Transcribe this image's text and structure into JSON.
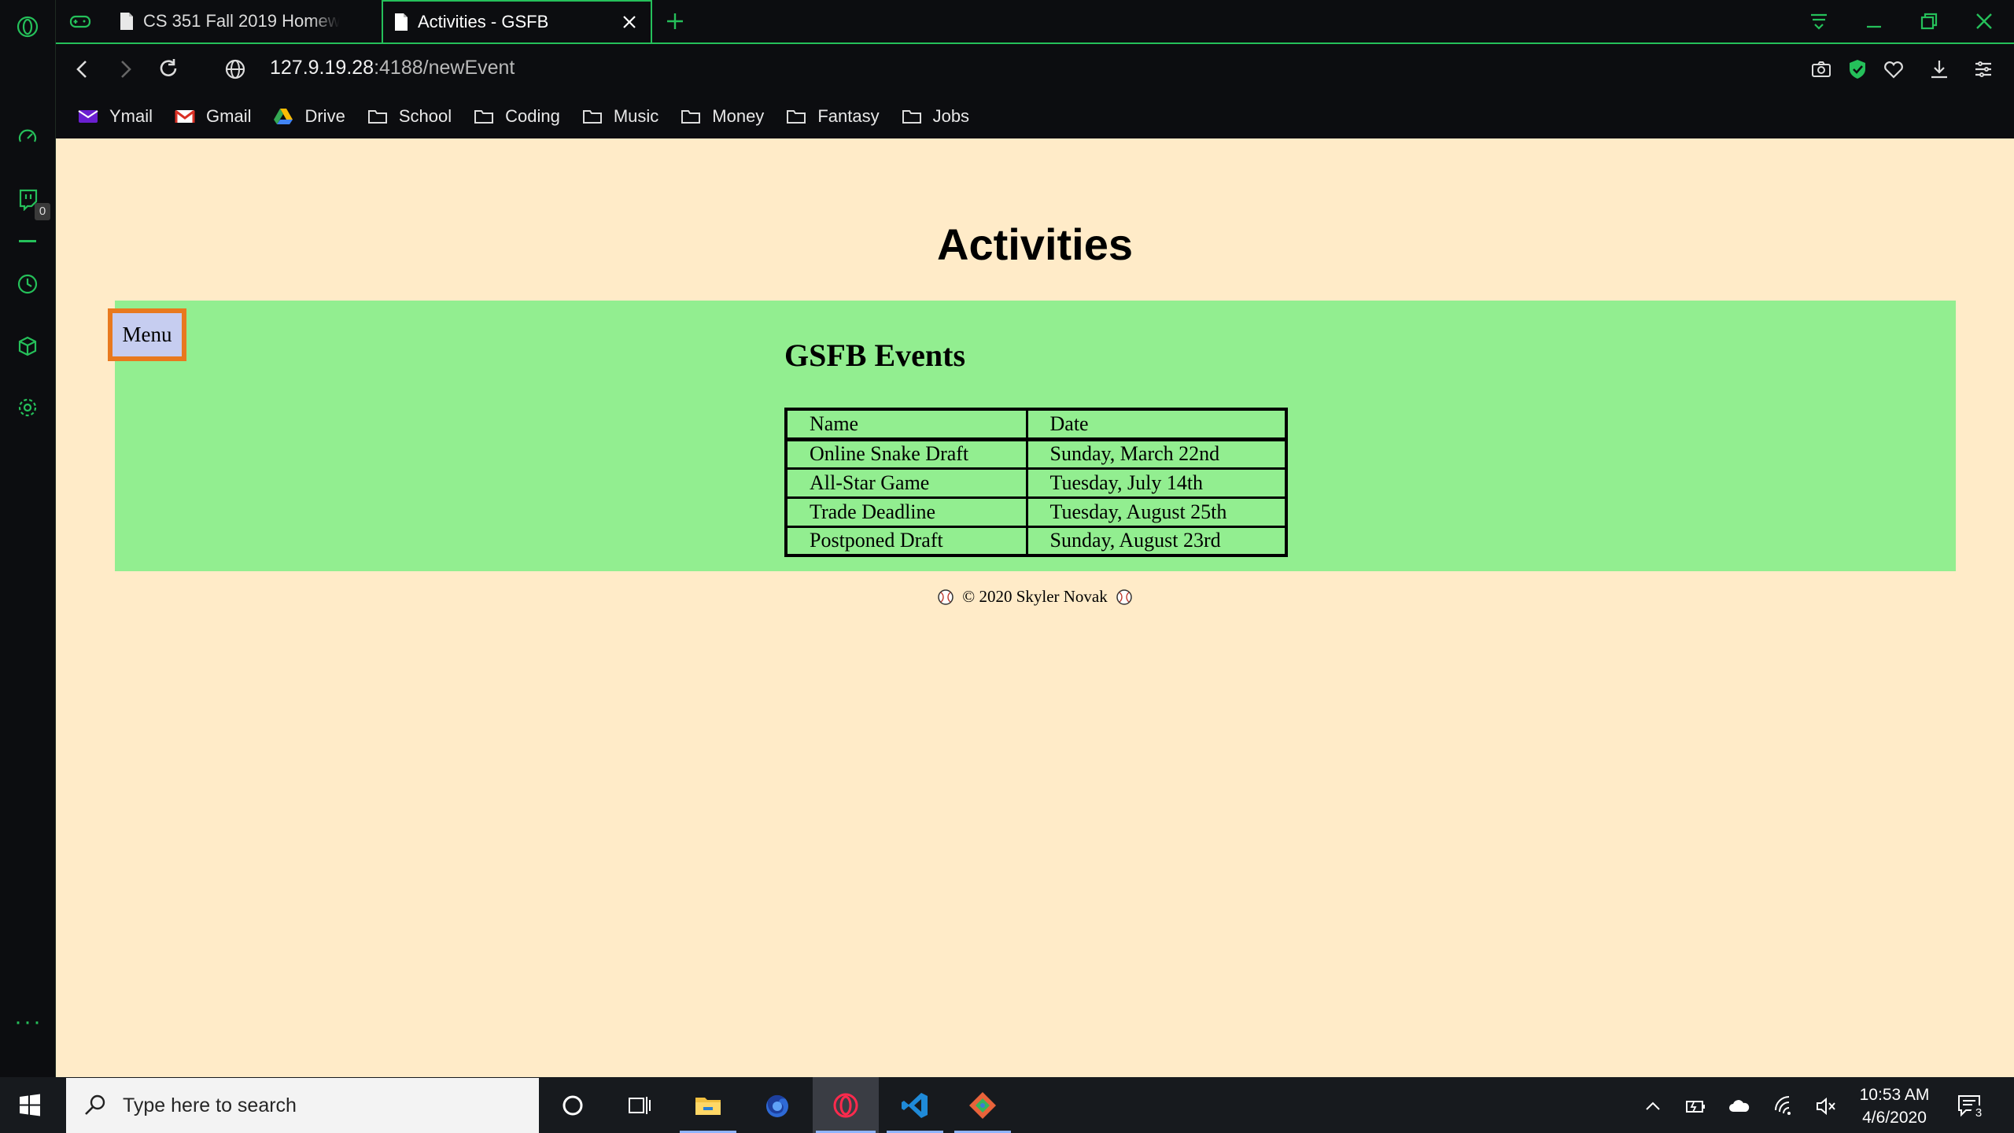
{
  "browser": {
    "tabs": [
      {
        "label": "CS 351 Fall 2019 Homework"
      },
      {
        "label": "Activities - GSFB"
      }
    ],
    "address": {
      "host": "127.9.19.28",
      "rest": ":4188/newEvent"
    },
    "bookmarks": [
      "Ymail",
      "Gmail",
      "Drive",
      "School",
      "Coding",
      "Music",
      "Money",
      "Fantasy",
      "Jobs"
    ],
    "sidebar_badge": "0",
    "accent_color": "#25c05a"
  },
  "page": {
    "title": "Activities",
    "menu_label": "Menu",
    "events_heading": "GSFB Events",
    "table": {
      "headers": [
        "Name",
        "Date"
      ],
      "rows": [
        [
          "Online Snake Draft",
          "Sunday, March 22nd"
        ],
        [
          "All-Star Game",
          "Tuesday, July 14th"
        ],
        [
          "Trade Deadline",
          "Tuesday, August 25th"
        ],
        [
          "Postponed Draft",
          "Sunday, August 23rd"
        ]
      ]
    },
    "footer": "© 2020 Skyler Novak",
    "colors": {
      "background": "#ffebc8",
      "panel": "#92ee90",
      "menu_border": "#e8791e",
      "menu_bg": "#c6cdf0"
    }
  },
  "taskbar": {
    "search_placeholder": "Type here to search",
    "time": "10:53 AM",
    "date": "4/6/2020",
    "notifications": "3"
  }
}
